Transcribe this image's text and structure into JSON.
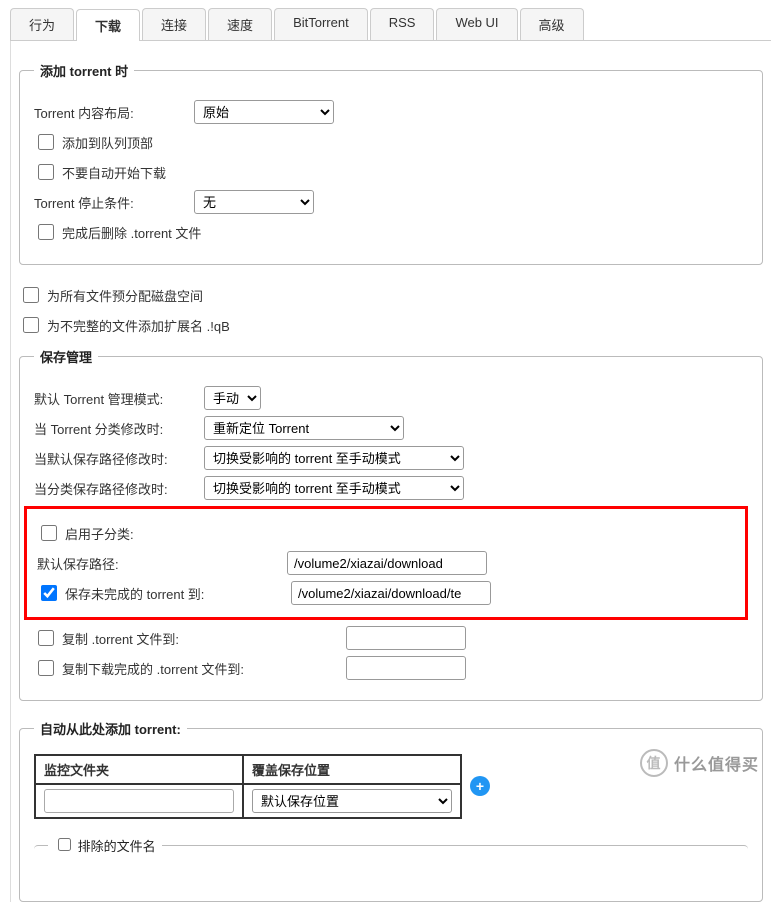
{
  "tabs": {
    "behavior": "行为",
    "downloads": "下载",
    "connection": "连接",
    "speed": "速度",
    "bittorrent": "BitTorrent",
    "rss": "RSS",
    "webui": "Web UI",
    "advanced": "高级"
  },
  "add_torrent": {
    "legend": "添加 torrent 时",
    "content_layout_label": "Torrent 内容布局:",
    "content_layout_value": "原始",
    "add_top_queue": "添加到队列顶部",
    "no_auto_start": "不要自动开始下载",
    "stop_condition_label": "Torrent 停止条件:",
    "stop_condition_value": "无",
    "delete_after": "完成后删除 .torrent 文件"
  },
  "free_options": {
    "preallocate": "为所有文件预分配磁盘空间",
    "append_ext": "为不完整的文件添加扩展名 .!qB"
  },
  "save_mgmt": {
    "legend": "保存管理",
    "default_mode_label": "默认 Torrent 管理模式:",
    "default_mode_value": "手动",
    "on_category_change_label": "当 Torrent 分类修改时:",
    "on_category_change_value": "重新定位 Torrent",
    "on_default_path_change_label": "当默认保存路径修改时:",
    "on_default_path_change_value": "切换受影响的 torrent 至手动模式",
    "on_category_path_change_label": "当分类保存路径修改时:",
    "on_category_path_change_value": "切换受影响的 torrent 至手动模式",
    "enable_subcategories": "启用子分类:",
    "default_save_path_label": "默认保存路径:",
    "default_save_path_value": "/volume2/xiazai/download",
    "incomplete_path_label": "保存未完成的 torrent 到:",
    "incomplete_path_value": "/volume2/xiazai/download/te",
    "copy_torrent_to": "复制 .torrent 文件到:",
    "copy_finished_to": "复制下载完成的 .torrent 文件到:"
  },
  "auto_add": {
    "legend": "自动从此处添加 torrent:",
    "col_folder": "监控文件夹",
    "col_override": "覆盖保存位置",
    "row_override_value": "默认保存位置",
    "exclude_label": "排除的文件名"
  },
  "watermark": {
    "text": "什么值得买",
    "badge": "值"
  }
}
